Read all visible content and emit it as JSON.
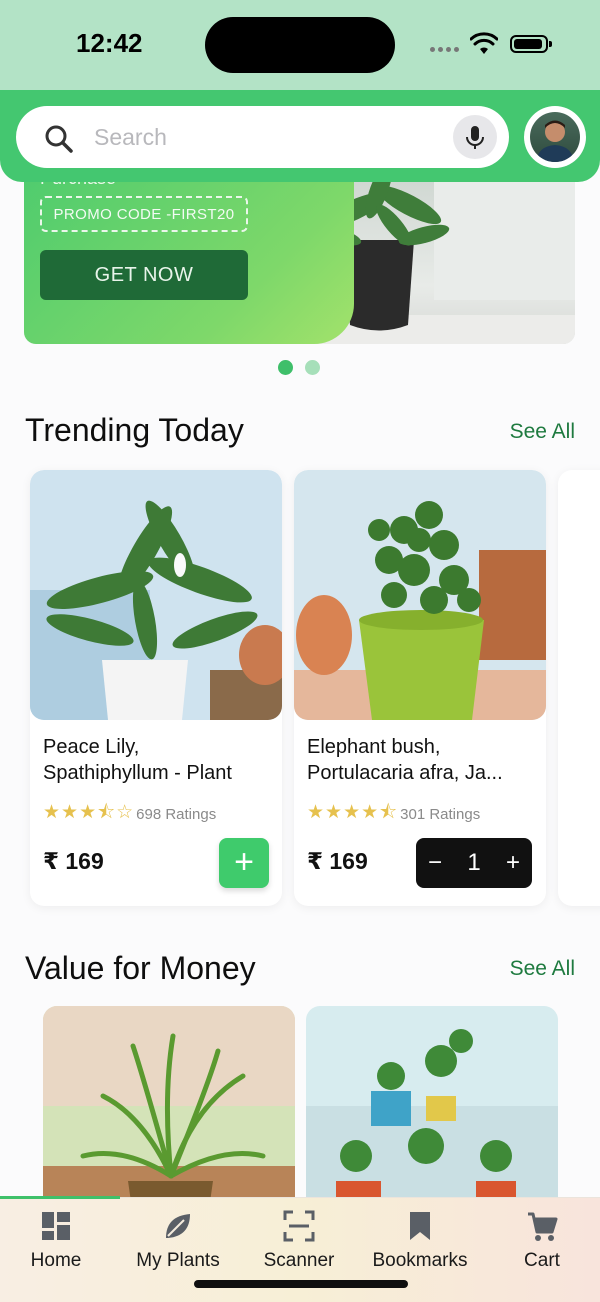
{
  "status_bar": {
    "time": "12:42"
  },
  "search": {
    "placeholder": "Search"
  },
  "banner": {
    "subtitle": "Purchase",
    "promo_code": "PROMO CODE -FIRST20",
    "cta": "GET NOW",
    "page_count": 2,
    "active_page": 1
  },
  "trending": {
    "title": "Trending Today",
    "see_all": "See All",
    "products": [
      {
        "name": "Peace Lily,\nSpathiphyllum - Plant",
        "stars": 3.5,
        "ratings": "698 Ratings",
        "price": "₹ 169",
        "action": "+",
        "in_cart": false
      },
      {
        "name": "Elephant bush,\nPortulacaria afra, Ja...",
        "stars": 4.5,
        "ratings": "301 Ratings",
        "price": "₹ 169",
        "quantity": "1",
        "minus": "−",
        "plus": "+",
        "in_cart": true
      }
    ]
  },
  "value": {
    "title": "Value for Money",
    "see_all": "See All"
  },
  "nav": {
    "items": [
      {
        "label": "Home",
        "icon": "grid-icon"
      },
      {
        "label": "My Plants",
        "icon": "leaf-icon"
      },
      {
        "label": "Scanner",
        "icon": "scanner-icon"
      },
      {
        "label": "Bookmarks",
        "icon": "bookmark-icon"
      },
      {
        "label": "Cart",
        "icon": "cart-icon"
      }
    ],
    "active": "Home"
  },
  "colors": {
    "brand_green": "#44c770",
    "dark_green": "#1f6a37",
    "link_green": "#1e7a3f",
    "star": "#e6c14e"
  }
}
